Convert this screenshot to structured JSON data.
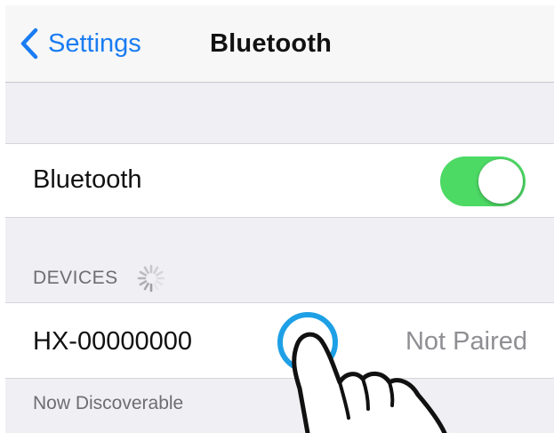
{
  "navbar": {
    "back_label": "Settings",
    "title": "Bluetooth"
  },
  "bluetooth_toggle": {
    "label": "Bluetooth",
    "on": true
  },
  "devices": {
    "header": "DEVICES",
    "items": [
      {
        "name": "HX-00000000",
        "status": "Not Paired"
      }
    ]
  },
  "footer": {
    "text": "Now Discoverable"
  },
  "colors": {
    "accent": "#1a7cf2",
    "switch_on": "#4cd964",
    "background": "#efeff4",
    "tap_ring": "#1ea0e6"
  },
  "icons": {
    "back": "chevron-left-icon",
    "scanning": "spinner-icon",
    "pointer": "hand-pointer-icon"
  }
}
